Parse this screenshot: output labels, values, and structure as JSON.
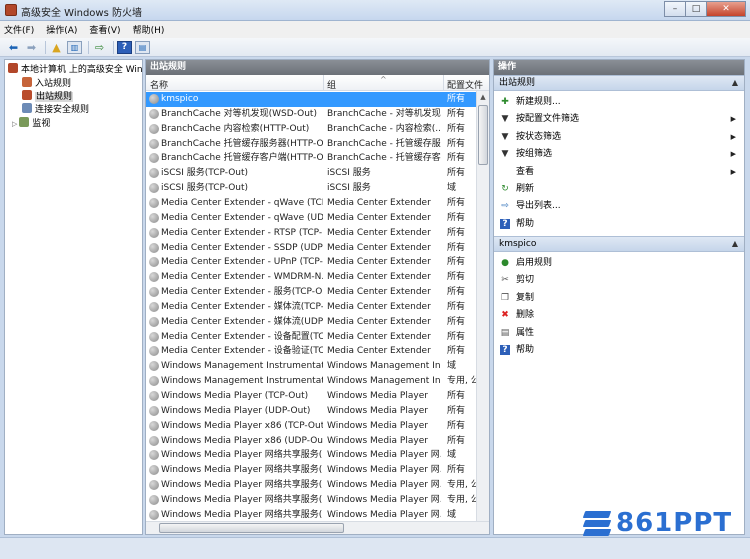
{
  "window": {
    "title": "高级安全 Windows 防火墙",
    "controls": {
      "minimize": "–",
      "maximize": "□",
      "close": "✕"
    }
  },
  "menu": [
    "文件(F)",
    "操作(A)",
    "查看(V)",
    "帮助(H)"
  ],
  "toolbar": {
    "icons": [
      "back-arrow-icon",
      "forward-arrow-icon",
      "up-folder-icon",
      "show-tree-icon",
      "export-icon",
      "help-icon",
      "properties-icon"
    ],
    "help_label": "?"
  },
  "tree": {
    "root": "本地计算机 上的高级安全 Windows 防火墙",
    "items": [
      "入站规则",
      "出站规则",
      "连接安全规则",
      "监视"
    ],
    "expander": "▷"
  },
  "middle": {
    "header": "出站规则",
    "columns": [
      "名称",
      "组",
      "配置文件"
    ],
    "sort_indicator": "^",
    "rows": [
      [
        "kmspico",
        "",
        "所有"
      ],
      [
        "BranchCache 对等机发现(WSD-Out)",
        "BranchCache - 对等机发现...",
        "所有"
      ],
      [
        "BranchCache 内容检索(HTTP-Out)",
        "BranchCache - 内容检索(...",
        "所有"
      ],
      [
        "BranchCache 托管缓存服务器(HTTP-O...",
        "BranchCache - 托管缓存服...",
        "所有"
      ],
      [
        "BranchCache 托管缓存客户端(HTTP-O...",
        "BranchCache - 托管缓存客...",
        "所有"
      ],
      [
        "iSCSI 服务(TCP-Out)",
        "iSCSI 服务",
        "所有"
      ],
      [
        "iSCSI 服务(TCP-Out)",
        "iSCSI 服务",
        "域"
      ],
      [
        "Media Center Extender - qWave (TCP...",
        "Media Center Extender",
        "所有"
      ],
      [
        "Media Center Extender - qWave (UD...",
        "Media Center Extender",
        "所有"
      ],
      [
        "Media Center Extender - RTSP (TCP-...",
        "Media Center Extender",
        "所有"
      ],
      [
        "Media Center Extender - SSDP (UDP-...",
        "Media Center Extender",
        "所有"
      ],
      [
        "Media Center Extender - UPnP (TCP-...",
        "Media Center Extender",
        "所有"
      ],
      [
        "Media Center Extender - WMDRM-N...",
        "Media Center Extender",
        "所有"
      ],
      [
        "Media Center Extender - 服务(TCP-O...",
        "Media Center Extender",
        "所有"
      ],
      [
        "Media Center Extender - 媒体流(TCP-...",
        "Media Center Extender",
        "所有"
      ],
      [
        "Media Center Extender - 媒体流(UDP-...",
        "Media Center Extender",
        "所有"
      ],
      [
        "Media Center Extender - 设备配置(TC...",
        "Media Center Extender",
        "所有"
      ],
      [
        "Media Center Extender - 设备验证(TC...",
        "Media Center Extender",
        "所有"
      ],
      [
        "Windows Management Instrumentati...",
        "Windows Management In...",
        "域"
      ],
      [
        "Windows Management Instrumentati...",
        "Windows Management In...",
        "专用, 公"
      ],
      [
        "Windows Media Player (TCP-Out)",
        "Windows Media Player",
        "所有"
      ],
      [
        "Windows Media Player (UDP-Out)",
        "Windows Media Player",
        "所有"
      ],
      [
        "Windows Media Player x86 (TCP-Out)",
        "Windows Media Player",
        "所有"
      ],
      [
        "Windows Media Player x86 (UDP-Out)",
        "Windows Media Player",
        "所有"
      ],
      [
        "Windows Media Player 网络共享服务(...",
        "Windows Media Player 网...",
        "域"
      ],
      [
        "Windows Media Player 网络共享服务(...",
        "Windows Media Player 网...",
        "所有"
      ],
      [
        "Windows Media Player 网络共享服务(...",
        "Windows Media Player 网...",
        "专用, 公"
      ],
      [
        "Windows Media Player 网络共享服务(...",
        "Windows Media Player 网...",
        "专用, 公"
      ],
      [
        "Windows Media Player 网络共享服务(...",
        "Windows Media Player 网...",
        "域"
      ],
      [
        "Windows Media Player 网络共享服务(...",
        "Windows Media Player 网...",
        "专用, 公"
      ]
    ]
  },
  "actions": {
    "header": "操作",
    "section1": {
      "title": "出站规则",
      "items": [
        {
          "label": "新建规则...",
          "icon": "new-rule-icon",
          "sub": false
        },
        {
          "label": "按配置文件筛选",
          "icon": "filter-icon",
          "sub": true
        },
        {
          "label": "按状态筛选",
          "icon": "filter-icon",
          "sub": true
        },
        {
          "label": "按组筛选",
          "icon": "filter-icon",
          "sub": true
        },
        {
          "label": "查看",
          "icon": "view-icon",
          "sub": true
        },
        {
          "label": "刷新",
          "icon": "refresh-icon",
          "sub": false
        },
        {
          "label": "导出列表...",
          "icon": "export-list-icon",
          "sub": false
        },
        {
          "label": "帮助",
          "icon": "help-icon",
          "sub": false
        }
      ]
    },
    "section2": {
      "title": "kmspico",
      "items": [
        {
          "label": "启用规则",
          "icon": "enable-rule-icon"
        },
        {
          "label": "剪切",
          "icon": "cut-icon"
        },
        {
          "label": "复制",
          "icon": "copy-icon"
        },
        {
          "label": "删除",
          "icon": "delete-icon"
        },
        {
          "label": "属性",
          "icon": "properties-icon"
        },
        {
          "label": "帮助",
          "icon": "help-icon"
        }
      ]
    },
    "caret": "▲",
    "submenu_arrow": "▶"
  },
  "watermark": {
    "text": "861PPT"
  },
  "colors": {
    "selection": "#3399ff",
    "watermark": "#2b6fd1"
  }
}
